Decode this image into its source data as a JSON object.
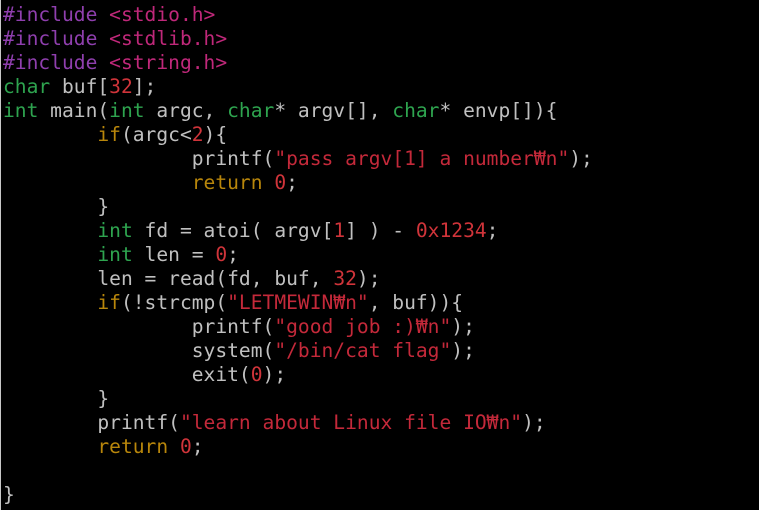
{
  "editor": {
    "lines": [
      [
        {
          "t": "#include ",
          "c": "pre"
        },
        {
          "t": "<stdio.h>",
          "c": "inc"
        }
      ],
      [
        {
          "t": "#include ",
          "c": "pre"
        },
        {
          "t": "<stdlib.h>",
          "c": "inc"
        }
      ],
      [
        {
          "t": "#include ",
          "c": "pre"
        },
        {
          "t": "<string.h>",
          "c": "inc"
        }
      ],
      [
        {
          "t": "char",
          "c": "type"
        },
        {
          "t": " buf[",
          "c": "plain"
        },
        {
          "t": "32",
          "c": "num"
        },
        {
          "t": "];",
          "c": "plain"
        }
      ],
      [
        {
          "t": "int",
          "c": "type"
        },
        {
          "t": " main(",
          "c": "plain"
        },
        {
          "t": "int",
          "c": "type"
        },
        {
          "t": " argc, ",
          "c": "plain"
        },
        {
          "t": "char",
          "c": "type"
        },
        {
          "t": "* argv[], ",
          "c": "plain"
        },
        {
          "t": "char",
          "c": "type"
        },
        {
          "t": "* envp[]){",
          "c": "plain"
        }
      ],
      [
        {
          "t": "        ",
          "c": "plain"
        },
        {
          "t": "if",
          "c": "kw"
        },
        {
          "t": "(argc<",
          "c": "plain"
        },
        {
          "t": "2",
          "c": "num"
        },
        {
          "t": "){",
          "c": "plain"
        }
      ],
      [
        {
          "t": "                printf(",
          "c": "plain"
        },
        {
          "t": "\"pass argv[1] a number",
          "c": "str"
        },
        {
          "t": "₩n",
          "c": "esc"
        },
        {
          "t": "\"",
          "c": "str"
        },
        {
          "t": ");",
          "c": "plain"
        }
      ],
      [
        {
          "t": "                ",
          "c": "plain"
        },
        {
          "t": "return",
          "c": "kw"
        },
        {
          "t": " ",
          "c": "plain"
        },
        {
          "t": "0",
          "c": "num"
        },
        {
          "t": ";",
          "c": "plain"
        }
      ],
      [
        {
          "t": "        }",
          "c": "plain"
        }
      ],
      [
        {
          "t": "        ",
          "c": "plain"
        },
        {
          "t": "int",
          "c": "type"
        },
        {
          "t": " fd = atoi( argv[",
          "c": "plain"
        },
        {
          "t": "1",
          "c": "num"
        },
        {
          "t": "] ) - ",
          "c": "plain"
        },
        {
          "t": "0x1234",
          "c": "num"
        },
        {
          "t": ";",
          "c": "plain"
        }
      ],
      [
        {
          "t": "        ",
          "c": "plain"
        },
        {
          "t": "int",
          "c": "type"
        },
        {
          "t": " len = ",
          "c": "plain"
        },
        {
          "t": "0",
          "c": "num"
        },
        {
          "t": ";",
          "c": "plain"
        }
      ],
      [
        {
          "t": "        len = read(fd, buf, ",
          "c": "plain"
        },
        {
          "t": "32",
          "c": "num"
        },
        {
          "t": ");",
          "c": "plain"
        }
      ],
      [
        {
          "t": "        ",
          "c": "plain"
        },
        {
          "t": "if",
          "c": "kw"
        },
        {
          "t": "(!strcmp(",
          "c": "plain"
        },
        {
          "t": "\"LETMEWIN",
          "c": "str"
        },
        {
          "t": "₩n",
          "c": "esc"
        },
        {
          "t": "\"",
          "c": "str"
        },
        {
          "t": ", buf)){",
          "c": "plain"
        }
      ],
      [
        {
          "t": "                printf(",
          "c": "plain"
        },
        {
          "t": "\"good job :)",
          "c": "str"
        },
        {
          "t": "₩n",
          "c": "esc"
        },
        {
          "t": "\"",
          "c": "str"
        },
        {
          "t": ");",
          "c": "plain"
        }
      ],
      [
        {
          "t": "                system(",
          "c": "plain"
        },
        {
          "t": "\"/bin/cat flag\"",
          "c": "str"
        },
        {
          "t": ");",
          "c": "plain"
        }
      ],
      [
        {
          "t": "                exit(",
          "c": "plain"
        },
        {
          "t": "0",
          "c": "num"
        },
        {
          "t": ");",
          "c": "plain"
        }
      ],
      [
        {
          "t": "        }",
          "c": "plain"
        }
      ],
      [
        {
          "t": "        printf(",
          "c": "plain"
        },
        {
          "t": "\"learn about Linux file IO",
          "c": "str"
        },
        {
          "t": "₩n",
          "c": "esc"
        },
        {
          "t": "\"",
          "c": "str"
        },
        {
          "t": ");",
          "c": "plain"
        }
      ],
      [
        {
          "t": "        ",
          "c": "plain"
        },
        {
          "t": "return",
          "c": "kw"
        },
        {
          "t": " ",
          "c": "plain"
        },
        {
          "t": "0",
          "c": "num"
        },
        {
          "t": ";",
          "c": "plain"
        }
      ],
      [],
      [
        {
          "t": "}",
          "c": "plain"
        }
      ]
    ]
  },
  "colors": {
    "background": "#000000",
    "preprocessor": "#8f3fae",
    "include_path": "#c0287a",
    "type": "#2ea44f",
    "keyword": "#b8860b",
    "number": "#d0343a",
    "string": "#c4293a",
    "plain": "#c0c0c0"
  }
}
